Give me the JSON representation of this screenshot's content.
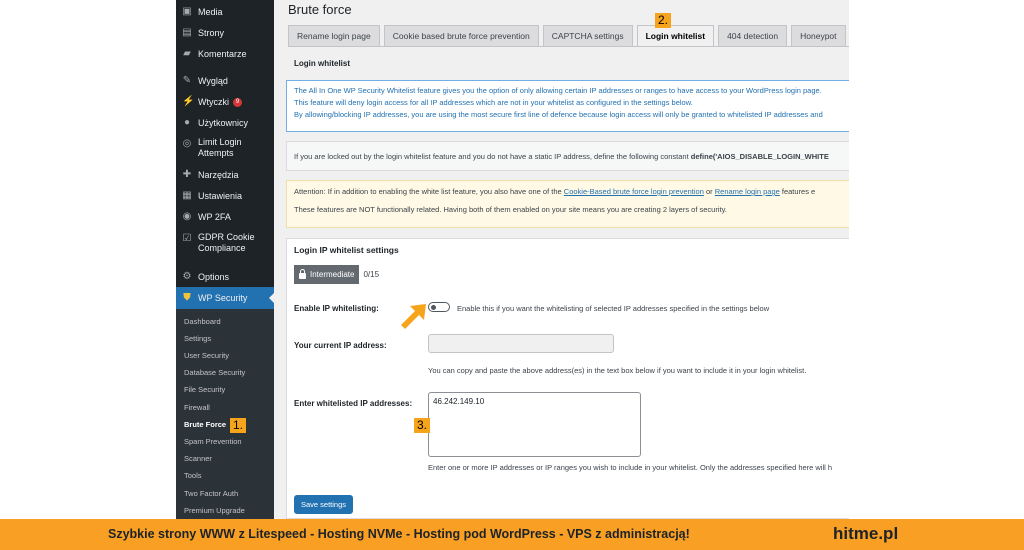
{
  "sidebar": {
    "items": [
      {
        "icon": "media-icon",
        "label": "Media"
      },
      {
        "icon": "pages-icon",
        "label": "Strony"
      },
      {
        "icon": "comments-icon",
        "label": "Komentarze"
      },
      {
        "icon": "appearance-icon",
        "label": "Wygląd"
      },
      {
        "icon": "plugins-icon",
        "label": "Wtyczki",
        "badge": "9"
      },
      {
        "icon": "users-icon",
        "label": "Użytkownicy"
      },
      {
        "icon": "limit-login-icon",
        "label": "Limit Login Attempts"
      },
      {
        "icon": "tools-icon",
        "label": "Narzędzia"
      },
      {
        "icon": "settings-icon",
        "label": "Ustawienia"
      },
      {
        "icon": "wp2fa-icon",
        "label": "WP 2FA"
      },
      {
        "icon": "gdpr-icon",
        "label": "GDPR Cookie Compliance"
      },
      {
        "icon": "options-icon",
        "label": "Options"
      },
      {
        "icon": "shield-icon",
        "label": "WP Security"
      }
    ],
    "submenu": [
      "Dashboard",
      "Settings",
      "User Security",
      "Database Security",
      "File Security",
      "Firewall",
      "Brute Force",
      "Spam Prevention",
      "Scanner",
      "Tools",
      "Two Factor Auth",
      "Premium Upgrade"
    ],
    "current_sub": "Brute Force"
  },
  "page": {
    "title": "Brute force",
    "tabs": [
      "Rename login page",
      "Cookie based brute force prevention",
      "CAPTCHA settings",
      "Login whitelist",
      "404 detection",
      "Honeypot"
    ],
    "active_tab": "Login whitelist",
    "section_title": "Login whitelist",
    "info_lines": [
      "The All In One WP Security Whitelist feature gives you the option of only allowing certain IP addresses or ranges to have access to your WordPress login page.",
      "This feature will deny login access for all IP addresses which are not in your whitelist as configured in the settings below.",
      "By allowing/blocking IP addresses, you are using the most secure first line of defence because login access will only be granted to whitelisted IP addresses and"
    ],
    "lockout_text": "If you are locked out by the login whitelist feature and you do not have a static IP address, define the following constant",
    "lockout_constant": "define('AIOS_DISABLE_LOGIN_WHITE",
    "warn_prefix": "Attention: If in addition to enabling the white list feature, you also have one of the",
    "warn_link1": "Cookie-Based brute force login prevention",
    "warn_or": "or",
    "warn_link2": "Rename login page",
    "warn_suffix": "features e",
    "warn_line2": "These features are NOT functionally related. Having both of them enabled on your site means you are creating 2 layers of security."
  },
  "settings": {
    "title": "Login IP whitelist settings",
    "level": "Intermediate",
    "level_count": "0/15",
    "enable_label": "Enable IP whitelisting:",
    "enable_help": "Enable this if you want the whitelisting of selected IP addresses specified in the settings below",
    "enabled": false,
    "current_ip_label": "Your current IP address:",
    "current_ip_value": "",
    "current_ip_help": "You can copy and paste the above address(es) in the text box below if you want to include it in your login whitelist.",
    "whitelist_label": "Enter whitelisted IP addresses:",
    "whitelist_value": "46.242.149.10",
    "whitelist_help": "Enter one or more IP addresses or IP ranges you wish to include in your whitelist. Only the addresses specified here will h",
    "save_label": "Save settings"
  },
  "annotations": {
    "m1": "1.",
    "m2": "2.",
    "m3": "3."
  },
  "colors": {
    "accent": "#2271b1",
    "annotation": "#f7a41d",
    "footer": "#f89f24",
    "sidebar": "#1d2327"
  },
  "footer": {
    "text": "Szybkie strony WWW z Litespeed - Hosting  NVMe - Hosting pod WordPress - VPS z administracją!",
    "brand": "hitme.pl"
  }
}
